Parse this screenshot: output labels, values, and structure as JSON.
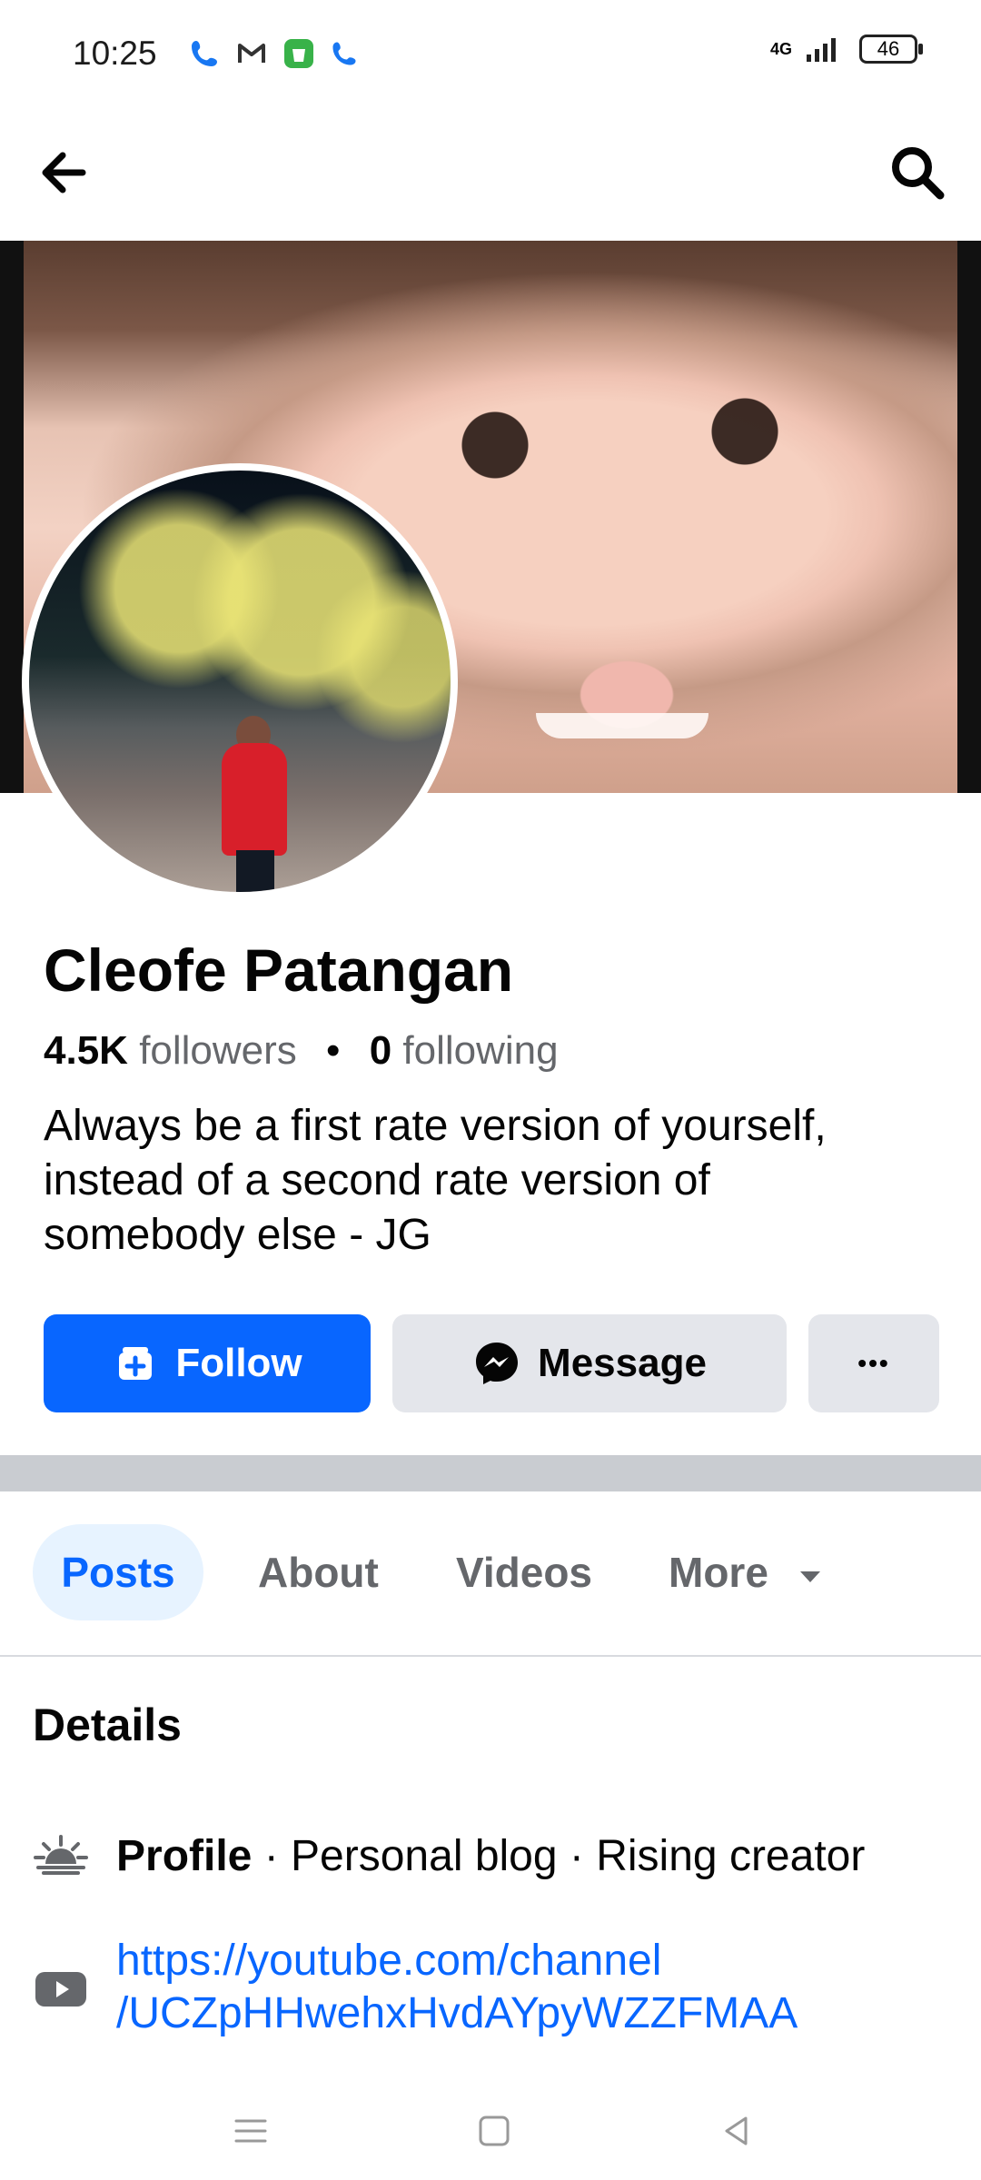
{
  "status_bar": {
    "time": "10:25",
    "network": "4G",
    "battery": "46",
    "icons": [
      "phone-icon",
      "gmail-icon",
      "shopping-app-icon",
      "phone-icon"
    ]
  },
  "header": {
    "back_icon": "arrow-left-icon",
    "search_icon": "search-icon"
  },
  "profile": {
    "name": "Cleofe Patangan",
    "followers_count": "4.5K",
    "followers_label": "followers",
    "separator": "•",
    "following_count": "0",
    "following_label": "following",
    "bio_line_1": "Always be a first rate  version of yourself,",
    "bio_line_2": "instead of a second rate version of",
    "bio_line_3": "somebody else - JG"
  },
  "actions": {
    "follow_label": "Follow",
    "message_label": "Message",
    "more_label": "•••"
  },
  "tabs": {
    "posts": "Posts",
    "about": "About",
    "videos": "Videos",
    "more": "More"
  },
  "details": {
    "title": "Details",
    "profile_bold": "Profile",
    "profile_rest": " · Personal blog · Rising creator",
    "link_line_1": "https://youtube.com/channel",
    "link_line_2": "/UCZpHHwehxHvdAYpyWZZFMAA"
  },
  "colors": {
    "brand_blue": "#0866ff",
    "button_gray": "#e4e6eb",
    "secondary_text": "#65676b"
  }
}
